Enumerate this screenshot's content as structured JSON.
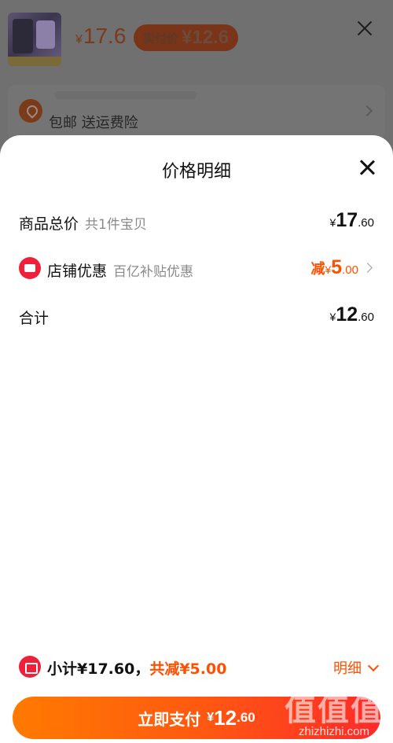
{
  "background": {
    "price_yen": "¥",
    "price_value": "17.6",
    "badge_label": "实付价",
    "badge_value": "¥12.6",
    "address_tags": "包邮  送运费险"
  },
  "sheet": {
    "title": "价格明细",
    "rows": [
      {
        "label": "商品总价",
        "sub": "共1件宝贝",
        "yen": "¥",
        "int": "17",
        "dec": ".60"
      },
      {
        "label": "店铺优惠",
        "sub": "百亿补贴优惠",
        "prefix": "减",
        "yen": "¥",
        "int": "5",
        "dec": ".00"
      },
      {
        "label": "合计",
        "yen": "¥",
        "int": "12",
        "dec": ".60"
      }
    ]
  },
  "footer": {
    "subtotal": "小计¥17.60，",
    "total_discount": "共减¥5.00",
    "detail_link": "明细",
    "pay_label": "立即支付",
    "pay_yen": "¥",
    "pay_int": "12",
    "pay_dec": ".60"
  },
  "watermark": {
    "text": "值值值",
    "site": "zhizhizhi.com"
  },
  "colors": {
    "accent": "#ff5000",
    "shop_icon": "#f0203a"
  }
}
